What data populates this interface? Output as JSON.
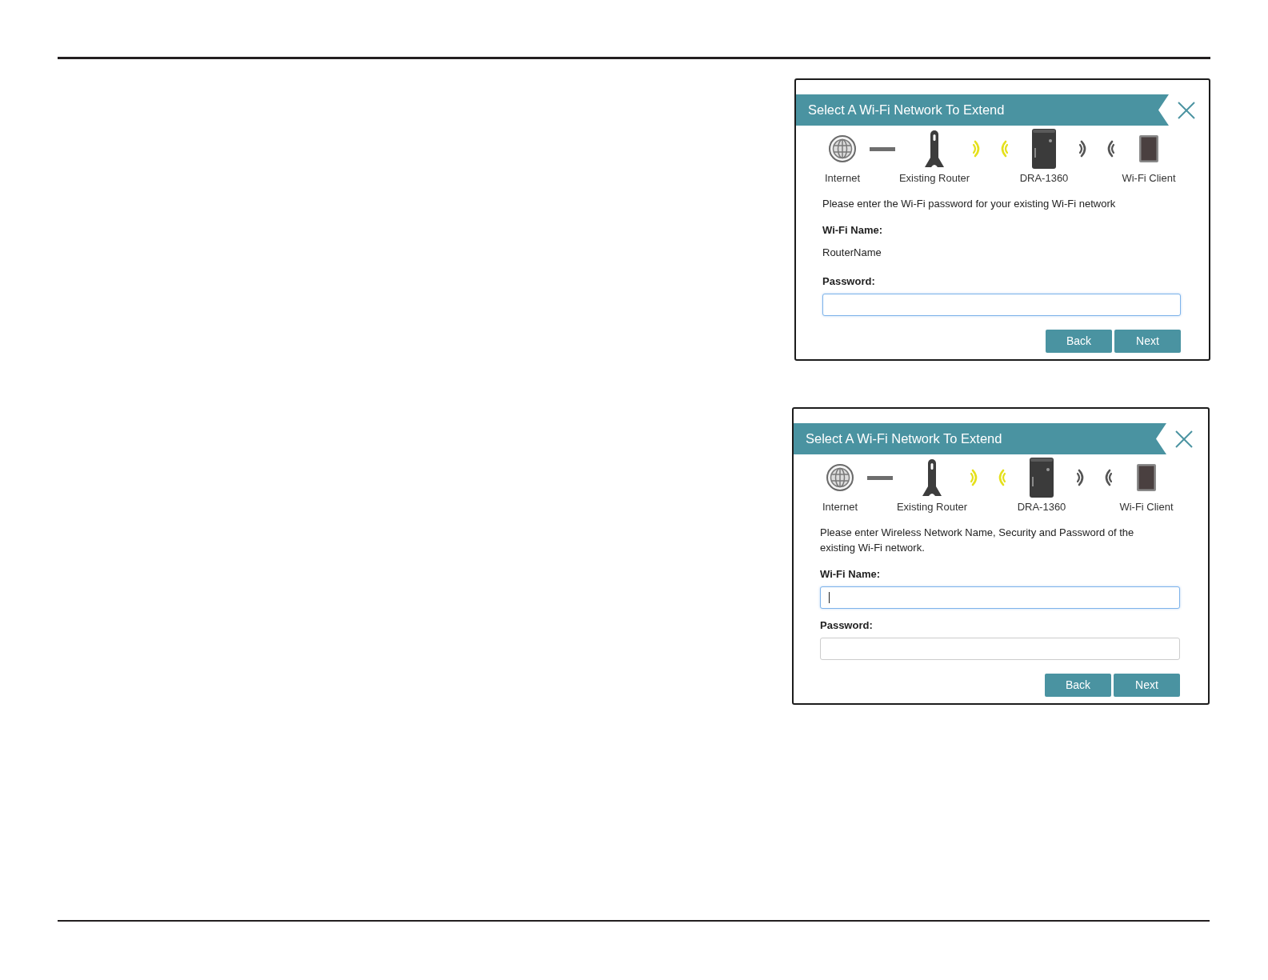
{
  "dialogs": [
    {
      "title": "Select A Wi-Fi Network To Extend",
      "diagram": [
        {
          "kind": "globe",
          "label": "Internet"
        },
        {
          "kind": "cable"
        },
        {
          "kind": "router",
          "label": "Existing Router"
        },
        {
          "kind": "waves",
          "color": "#e5e01c"
        },
        {
          "kind": "extender",
          "label": "DRA-1360"
        },
        {
          "kind": "waves",
          "color": "#555555"
        },
        {
          "kind": "tablet",
          "label": "Wi-Fi Client"
        }
      ],
      "instruction": "Please enter the Wi-Fi password for your existing Wi-Fi network",
      "fields": [
        {
          "kind": "text",
          "label": "Wi-Fi Name:",
          "value": "RouterName"
        },
        {
          "kind": "input",
          "label": "Password:",
          "focused": true,
          "caret": false
        }
      ],
      "buttons": [
        "Back",
        "Next"
      ]
    },
    {
      "title": "Select A Wi-Fi Network To Extend",
      "diagram": [
        {
          "kind": "globe",
          "label": "Internet"
        },
        {
          "kind": "cable"
        },
        {
          "kind": "router",
          "label": "Existing Router"
        },
        {
          "kind": "waves",
          "color": "#e5e01c"
        },
        {
          "kind": "extender",
          "label": "DRA-1360"
        },
        {
          "kind": "waves",
          "color": "#555555"
        },
        {
          "kind": "tablet",
          "label": "Wi-Fi Client"
        }
      ],
      "instruction": "Please enter Wireless Network Name, Security and Password of the existing Wi-Fi network.",
      "fields": [
        {
          "kind": "input",
          "label": "Wi-Fi Name:",
          "focused": true,
          "caret": true
        },
        {
          "kind": "input",
          "label": "Password:",
          "focused": false,
          "caret": false
        }
      ],
      "buttons": [
        "Back",
        "Next"
      ]
    }
  ]
}
